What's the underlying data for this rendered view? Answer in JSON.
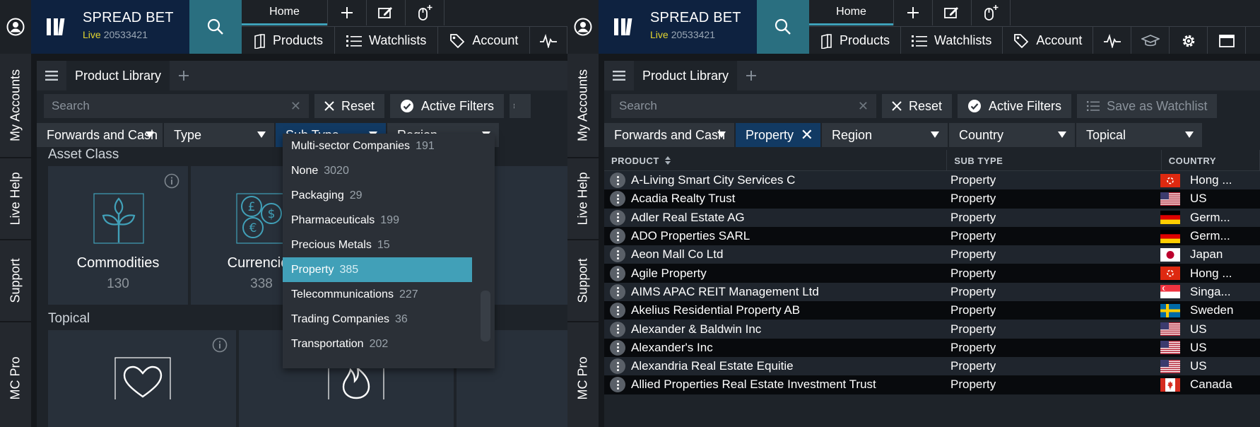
{
  "left": {
    "brand": {
      "title": "SPREAD BET",
      "live_label": "Live",
      "account_number": "20533421"
    },
    "home_tab": "Home",
    "nav": {
      "products": "Products",
      "watchlists": "Watchlists",
      "account": "Account"
    },
    "side_rail": [
      "My Accounts",
      "Live Help",
      "Support",
      "MC Pro"
    ],
    "panel_tab": "Product Library",
    "search": {
      "placeholder": "Search",
      "value": ""
    },
    "toolbar": {
      "reset": "Reset",
      "active_filters": "Active Filters"
    },
    "filters": [
      "Forwards and Cash",
      "Type",
      "Sub Type",
      "Region"
    ],
    "sections": {
      "asset_class": "Asset Class",
      "topical": "Topical"
    },
    "tiles": [
      {
        "name": "Commodities",
        "count": "130"
      },
      {
        "name": "Currencies",
        "count": "338"
      }
    ],
    "subtype_dropdown": [
      {
        "label": "Multi-sector Companies",
        "count": "191"
      },
      {
        "label": "None",
        "count": "3020"
      },
      {
        "label": "Packaging",
        "count": "29"
      },
      {
        "label": "Pharmaceuticals",
        "count": "199"
      },
      {
        "label": "Precious Metals",
        "count": "15"
      },
      {
        "label": "Property",
        "count": "385",
        "selected": true
      },
      {
        "label": "Telecommunications",
        "count": "227"
      },
      {
        "label": "Trading Companies",
        "count": "36"
      },
      {
        "label": "Transportation",
        "count": "202"
      }
    ]
  },
  "right": {
    "brand": {
      "title": "SPREAD BET",
      "live_label": "Live",
      "account_number": "20533421"
    },
    "home_tab": "Home",
    "nav": {
      "products": "Products",
      "watchlists": "Watchlists",
      "account": "Account"
    },
    "side_rail": [
      "My Accounts",
      "Live Help",
      "Support",
      "MC Pro"
    ],
    "panel_tab": "Product Library",
    "search": {
      "placeholder": "Search",
      "value": ""
    },
    "toolbar": {
      "reset": "Reset",
      "active_filters": "Active Filters",
      "save_watchlist": "Save as Watchlist"
    },
    "filters": [
      "Forwards and Cash",
      "Property",
      "Region",
      "Country",
      "Topical"
    ],
    "table": {
      "columns": [
        "PRODUCT",
        "SUB TYPE",
        "COUNTRY"
      ],
      "rows": [
        {
          "product": "A-Living Smart City Services C",
          "sub_type": "Property",
          "country": "Hong ...",
          "flag": "hk"
        },
        {
          "product": "Acadia Realty Trust",
          "sub_type": "Property",
          "country": "US",
          "flag": "us"
        },
        {
          "product": "Adler Real Estate AG",
          "sub_type": "Property",
          "country": "Germ...",
          "flag": "de"
        },
        {
          "product": "ADO Properties SARL",
          "sub_type": "Property",
          "country": "Germ...",
          "flag": "de"
        },
        {
          "product": "Aeon Mall Co Ltd",
          "sub_type": "Property",
          "country": "Japan",
          "flag": "jp"
        },
        {
          "product": "Agile Property",
          "sub_type": "Property",
          "country": "Hong ...",
          "flag": "hk"
        },
        {
          "product": "AIMS APAC REIT Management Ltd",
          "sub_type": "Property",
          "country": "Singa...",
          "flag": "sg"
        },
        {
          "product": "Akelius Residential Property AB",
          "sub_type": "Property",
          "country": "Sweden",
          "flag": "se"
        },
        {
          "product": "Alexander & Baldwin Inc",
          "sub_type": "Property",
          "country": "US",
          "flag": "us"
        },
        {
          "product": "Alexander's Inc",
          "sub_type": "Property",
          "country": "US",
          "flag": "us"
        },
        {
          "product": "Alexandria Real Estate Equitie",
          "sub_type": "Property",
          "country": "US",
          "flag": "us"
        },
        {
          "product": "Allied Properties Real Estate Investment Trust",
          "sub_type": "Property",
          "country": "Canada",
          "flag": "ca"
        }
      ]
    }
  },
  "colors": {
    "brand_bg": "#0e2240",
    "search_btn": "#2a6f80",
    "accent": "#41a0b8",
    "live": "#e2d530",
    "active_filter": "#123a63"
  }
}
